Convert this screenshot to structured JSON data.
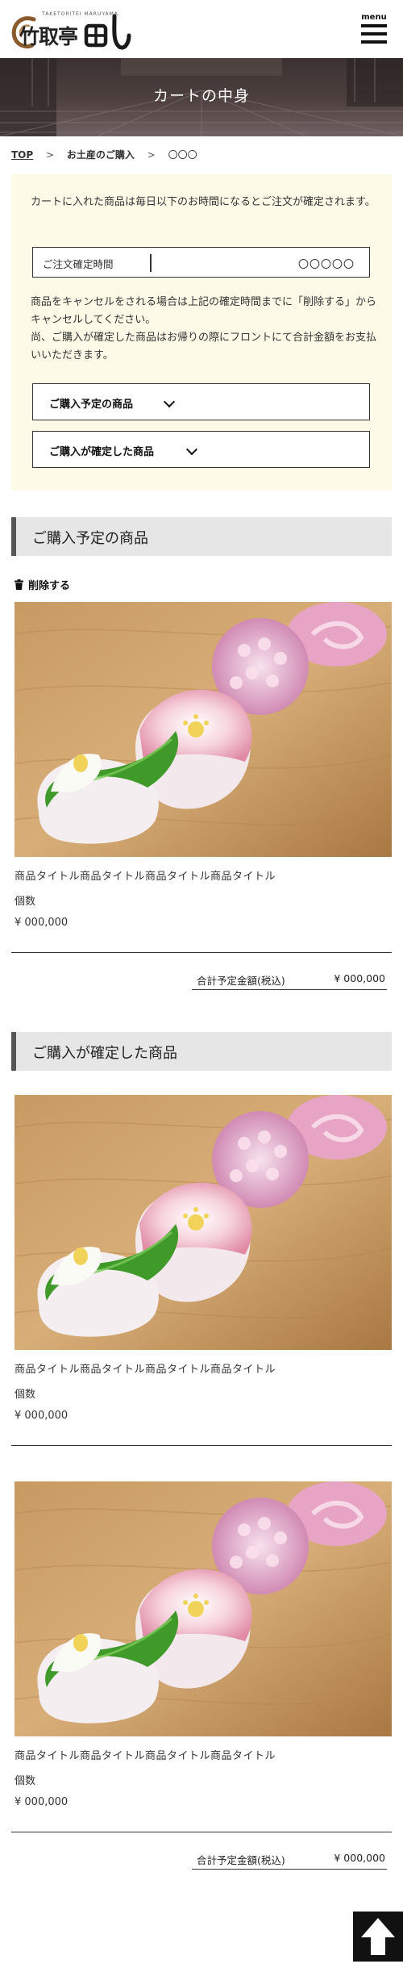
{
  "header": {
    "logo_small": "TAKETORITEI MARUYAMA",
    "logo_kanji": "竹取亭",
    "menu_label": "menu"
  },
  "hero": {
    "title": "カートの中身"
  },
  "breadcrumb": {
    "top": "TOP",
    "middle": "お土産のご購入",
    "current": "〇〇〇"
  },
  "info": {
    "text1": "カートに入れた商品は毎日以下のお時間になるとご注文が確定されます。",
    "time_label": "ご注文確定時間",
    "time_value": "〇〇〇〇〇",
    "text2a": "商品をキャンセルをされる場合は上記の確定時間までに「削除する」からキャンセルしてください。",
    "text2b": "尚、ご購入が確定した商品はお帰りの際にフロントにて合計金額をお支払いいただきます。",
    "accordion_planned": "ご購入予定の商品",
    "accordion_confirmed": "ご購入が確定した商品"
  },
  "planned": {
    "heading": "ご購入予定の商品",
    "delete_label": "削除する",
    "items": [
      {
        "title": "商品タイトル商品タイトル商品タイトル商品タイトル",
        "qty_label": "個数",
        "price": "¥ 000,000"
      }
    ],
    "total_label": "合計予定金額(税込)",
    "total_value": "¥ 000,000"
  },
  "confirmed": {
    "heading": "ご購入が確定した商品",
    "items": [
      {
        "title": "商品タイトル商品タイトル商品タイトル商品タイトル",
        "qty_label": "個数",
        "price": "¥ 000,000"
      },
      {
        "title": "商品タイトル商品タイトル商品タイトル商品タイトル",
        "qty_label": "個数",
        "price": "¥ 000,000"
      }
    ],
    "total_label": "合計予定金額(税込)",
    "total_value": "¥ 000,000"
  },
  "colors": {
    "info_bg": "#fdfae8",
    "section_heading_bg": "#e6e6e6",
    "section_heading_bar": "#555555",
    "hero_overlay": "#3a3030",
    "pagetop_bg": "#111111"
  },
  "icons": [
    "logo-swirl-icon",
    "menu-icon",
    "chevron-down-icon",
    "trash-icon",
    "arrow-up-icon"
  ]
}
